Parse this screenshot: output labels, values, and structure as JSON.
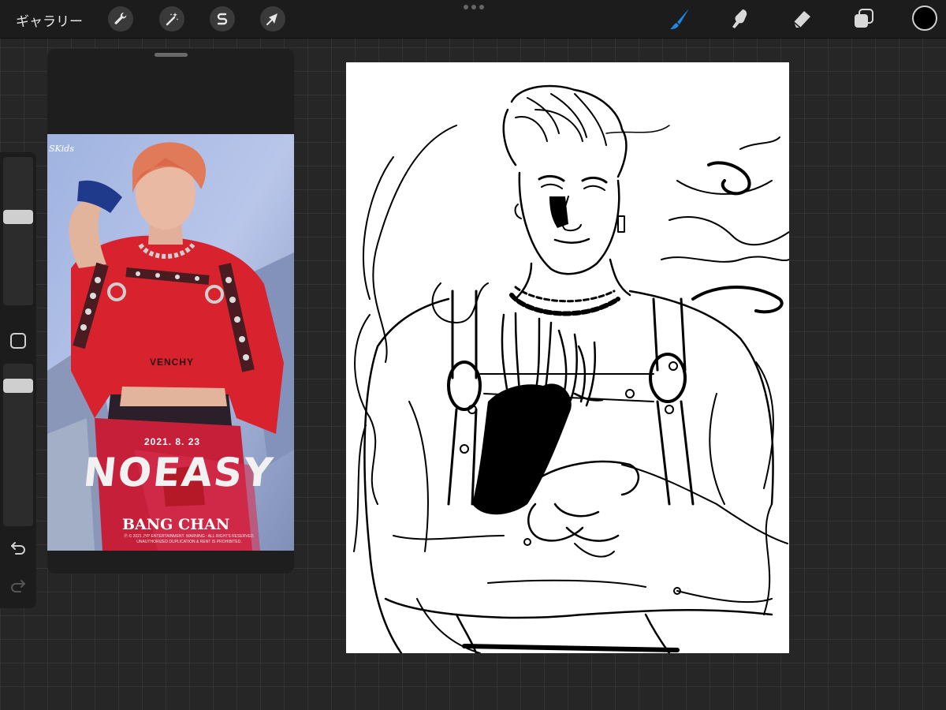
{
  "toolbar": {
    "gallery_label": "ギャラリー",
    "left_tools": [
      "wrench-icon",
      "magic-wand-icon",
      "selection-s-icon",
      "transform-arrow-icon"
    ],
    "right_tools": [
      "brush-icon",
      "smudge-icon",
      "eraser-icon",
      "layers-icon"
    ],
    "active_tool": "brush",
    "accent_color": "#1e88e5",
    "current_color": "#000000"
  },
  "reference": {
    "logo": "SKids",
    "brand_text": "VENCHY",
    "date": "2021. 8. 23",
    "title": "NOEASY",
    "member": "BANG CHAN",
    "fine_print": "Ⓟ © 2021 JYP ENTERTAINMENT. WARNING : ALL RIGHTS RESERVED. UNAUTHORIZED DUPLICATION & RENT IS PROHIBITED."
  },
  "sidebar": {
    "brush_size": 0.64,
    "brush_opacity": 0.8,
    "modify_button": "square-icon",
    "undo": "undo-icon",
    "redo": "redo-icon"
  }
}
